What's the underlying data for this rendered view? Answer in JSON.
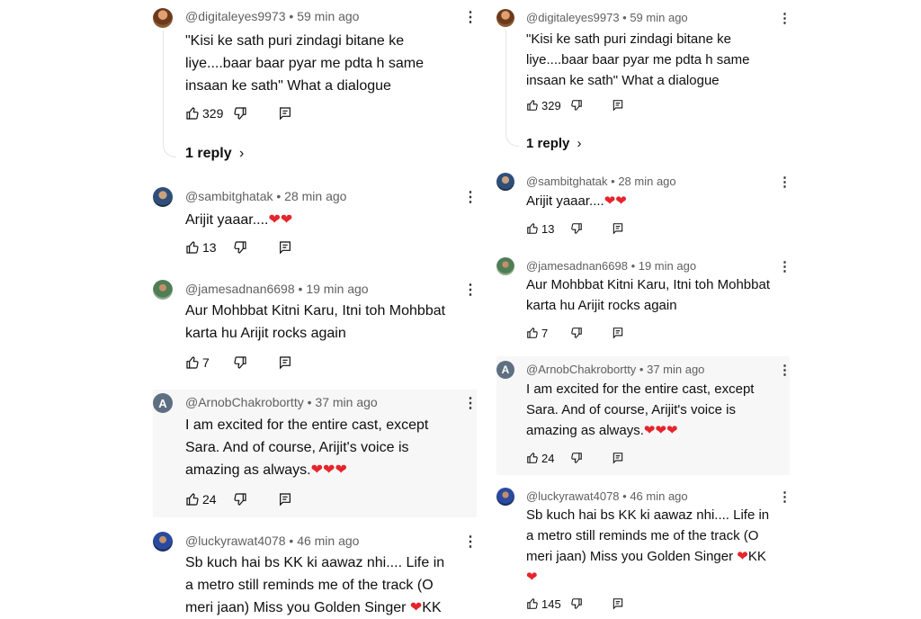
{
  "left": {
    "comments": [
      {
        "author": "@digitaleyes9973",
        "time": "59 min ago",
        "text": "\"Kisi ke sath puri zindagi bitane ke\nliye....baar baar pyar me pdta h same\ninsaan ke sath\" What a dialogue",
        "likes": "329",
        "replies": "1 reply",
        "avatar_letter": ""
      },
      {
        "author": "@sambitghatak",
        "time": "28 min ago",
        "text": "Arijit yaaar....",
        "hearts": "❤❤",
        "likes": "13",
        "avatar_letter": ""
      },
      {
        "author": "@jamesadnan6698",
        "time": "19 min ago",
        "text": "Aur Mohbbat Kitni Karu, Itni toh Mohbbat\nkarta hu Arijit rocks again",
        "likes": "7",
        "avatar_letter": ""
      },
      {
        "author": "@ArnobChakrobortty",
        "time": "37 min ago",
        "text": "I am excited for the entire cast, except\nSara. And of course, Arijit's voice is\namazing as always.",
        "hearts": "❤❤❤",
        "likes": "24",
        "avatar_letter": "A"
      },
      {
        "author": "@luckyrawat4078",
        "time": "46 min ago",
        "text": "Sb kuch hai bs KK ki aawaz nhi.... Life in\na metro still reminds me of the track (O\nmeri jaan) Miss you Golden Singer ",
        "hearts": "❤",
        "text_after": "KK",
        "likes": "",
        "avatar_letter": ""
      }
    ]
  },
  "right": {
    "comments": [
      {
        "author": "@digitaleyes9973",
        "time": "59 min ago",
        "text": "\"Kisi ke sath puri zindagi bitane ke\nliye....baar baar pyar me pdta h same\ninsaan ke sath\" What a dialogue",
        "likes": "329",
        "replies": "1 reply",
        "avatar_letter": ""
      },
      {
        "author": "@sambitghatak",
        "time": "28 min ago",
        "text": "Arijit yaaar....",
        "hearts": "❤❤",
        "likes": "13",
        "avatar_letter": ""
      },
      {
        "author": "@jamesadnan6698",
        "time": "19 min ago",
        "text": "Aur Mohbbat Kitni Karu, Itni toh Mohbbat\nkarta hu Arijit rocks again",
        "likes": "7",
        "avatar_letter": ""
      },
      {
        "author": "@ArnobChakrobortty",
        "time": "37 min ago",
        "text": "I am excited for the entire cast, except\nSara. And of course, Arijit's voice is\namazing as always.",
        "hearts": "❤❤❤",
        "likes": "24",
        "avatar_letter": "A"
      },
      {
        "author": "@luckyrawat4078",
        "time": "46 min ago",
        "text": "Sb kuch hai bs KK ki aawaz nhi.... Life in\na metro still reminds me of the track (O\nmeri jaan) Miss you Golden Singer ",
        "hearts": "❤",
        "text_after": "KK",
        "hearts_line2": "❤",
        "likes": "145",
        "avatar_letter": ""
      }
    ]
  },
  "icons": {
    "like": "thumbs-up-icon",
    "dislike": "thumbs-down-icon",
    "reply": "reply-comment-icon",
    "more": "more-vert-icon",
    "chevron": "chevron-right-icon"
  },
  "colors": {
    "heart": "#e5252c",
    "meta": "#606060",
    "text": "#0f0f0f",
    "highlight": "#f7f7f7"
  }
}
